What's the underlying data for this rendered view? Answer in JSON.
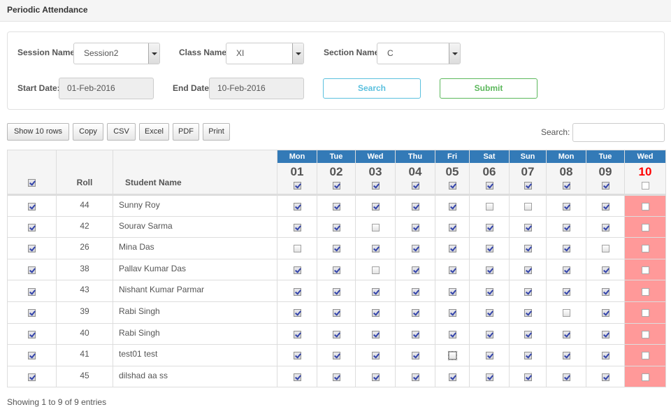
{
  "page": {
    "title": "Periodic Attendance"
  },
  "filters": {
    "session_label": "Session Name",
    "session_value": "Session2",
    "class_label": "Class Name",
    "class_value": "XI",
    "section_label": "Section Name",
    "section_value": "C",
    "start_label": "Start Date:",
    "start_value": "01-Feb-2016",
    "end_label": "End Date:",
    "end_value": "10-Feb-2016",
    "search_button": "Search",
    "submit_button": "Submit"
  },
  "toolbar": {
    "buttons": [
      "Show 10 rows",
      "Copy",
      "CSV",
      "Excel",
      "PDF",
      "Print"
    ],
    "search_label": "Search:",
    "search_value": ""
  },
  "table": {
    "select_all_checked": true,
    "headers": {
      "roll": "Roll",
      "name": "Student Name"
    },
    "days": [
      {
        "day": "Mon",
        "date": "01",
        "all_checked": true,
        "holiday": false
      },
      {
        "day": "Tue",
        "date": "02",
        "all_checked": true,
        "holiday": false
      },
      {
        "day": "Wed",
        "date": "03",
        "all_checked": true,
        "holiday": false
      },
      {
        "day": "Thu",
        "date": "04",
        "all_checked": true,
        "holiday": false
      },
      {
        "day": "Fri",
        "date": "05",
        "all_checked": true,
        "holiday": false
      },
      {
        "day": "Sat",
        "date": "06",
        "all_checked": true,
        "holiday": false
      },
      {
        "day": "Sun",
        "date": "07",
        "all_checked": true,
        "holiday": false
      },
      {
        "day": "Mon",
        "date": "08",
        "all_checked": true,
        "holiday": false
      },
      {
        "day": "Tue",
        "date": "09",
        "all_checked": true,
        "holiday": false
      },
      {
        "day": "Wed",
        "date": "10",
        "all_checked": false,
        "holiday": true
      }
    ],
    "holiday_color": "#ff9999",
    "header_color": "#337ab7",
    "rows": [
      {
        "selected": true,
        "roll": "44",
        "name": "Sunny Roy",
        "attendance": [
          1,
          1,
          1,
          1,
          1,
          0,
          0,
          1,
          1,
          0
        ]
      },
      {
        "selected": true,
        "roll": "42",
        "name": "Sourav Sarma",
        "attendance": [
          1,
          1,
          0,
          1,
          1,
          1,
          1,
          1,
          1,
          0
        ]
      },
      {
        "selected": true,
        "roll": "26",
        "name": "Mina Das",
        "attendance": [
          0,
          1,
          1,
          1,
          1,
          1,
          1,
          1,
          0,
          0
        ]
      },
      {
        "selected": true,
        "roll": "38",
        "name": "Pallav Kumar Das",
        "attendance": [
          1,
          1,
          0,
          1,
          1,
          1,
          1,
          1,
          1,
          0
        ]
      },
      {
        "selected": true,
        "roll": "43",
        "name": "Nishant Kumar Parmar",
        "attendance": [
          1,
          1,
          1,
          1,
          1,
          1,
          1,
          1,
          1,
          0
        ]
      },
      {
        "selected": true,
        "roll": "39",
        "name": "Rabi Singh",
        "attendance": [
          1,
          1,
          1,
          1,
          1,
          1,
          1,
          0,
          1,
          0
        ]
      },
      {
        "selected": true,
        "roll": "40",
        "name": "Rabi Singh",
        "attendance": [
          1,
          1,
          1,
          1,
          1,
          1,
          1,
          1,
          1,
          0
        ]
      },
      {
        "selected": true,
        "roll": "41",
        "name": "test01 test",
        "attendance": [
          1,
          1,
          1,
          1,
          0,
          1,
          1,
          1,
          1,
          0
        ],
        "focused_day": 4
      },
      {
        "selected": true,
        "roll": "45",
        "name": "dilshad aa ss",
        "attendance": [
          1,
          1,
          1,
          1,
          1,
          1,
          1,
          1,
          1,
          0
        ]
      }
    ]
  },
  "footer": {
    "info": "Showing 1 to 9 of 9 entries"
  }
}
